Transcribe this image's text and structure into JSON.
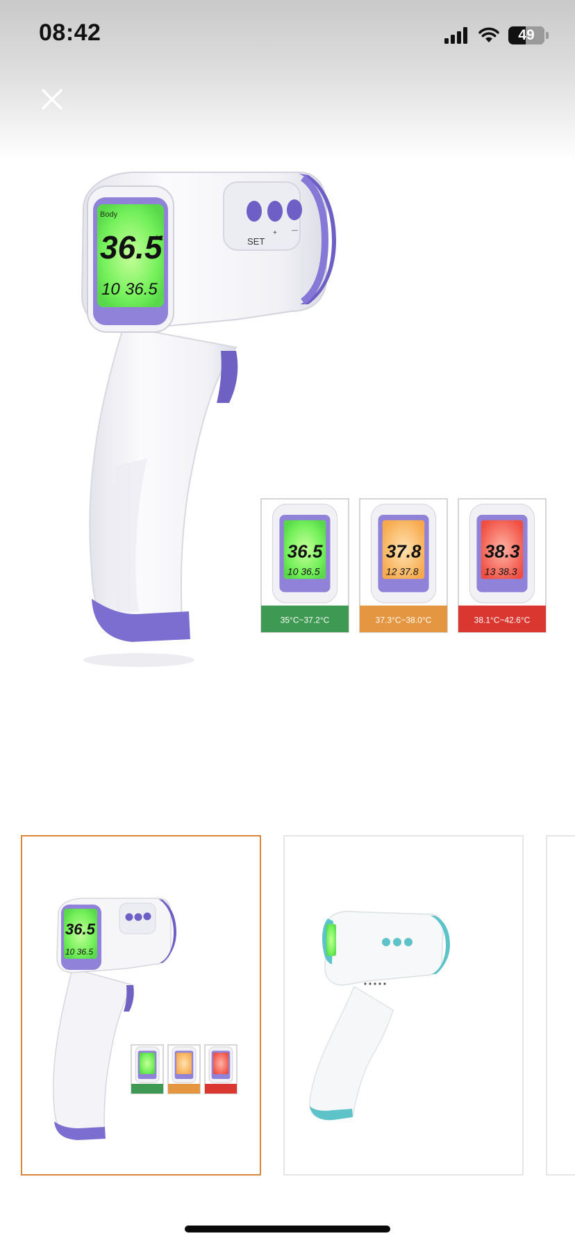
{
  "status_bar": {
    "time": "08:42",
    "battery": "49",
    "battery_level": 0.49
  },
  "colors": {
    "accent_selected_border": "#d9873b",
    "thermo_purple": "#6a5acd",
    "thermo_teal": "#5ec3c9",
    "normal_green": "#3e9a52",
    "mild_orange": "#e59640",
    "fever_red": "#d9372f"
  },
  "icons": {
    "close": "close-icon",
    "signal": "signal-icon",
    "wifi": "wifi-icon",
    "battery": "battery-icon"
  },
  "product_image": {
    "lcd": {
      "mode": "Body",
      "unit": "°C",
      "reading": "36.5",
      "memory_index": "10",
      "memory_value": "36.5"
    },
    "buttons": {
      "set": "SET",
      "plus": "+",
      "minus": "—"
    },
    "ranges": [
      {
        "reading": "36.5",
        "memory_index": "10",
        "memory_value": "36.5",
        "label": "35°C~37.2°C",
        "color": "#3e9a52"
      },
      {
        "reading": "37.8",
        "memory_index": "12",
        "memory_value": "37.8",
        "label": "37.3°C~38.0°C",
        "color": "#e59640"
      },
      {
        "reading": "38.3",
        "memory_index": "13",
        "memory_value": "38.3",
        "label": "38.1°C~42.6°C",
        "color": "#d9372f"
      }
    ]
  },
  "thumbnails": {
    "selected_index": 0,
    "count_visible": 3
  }
}
